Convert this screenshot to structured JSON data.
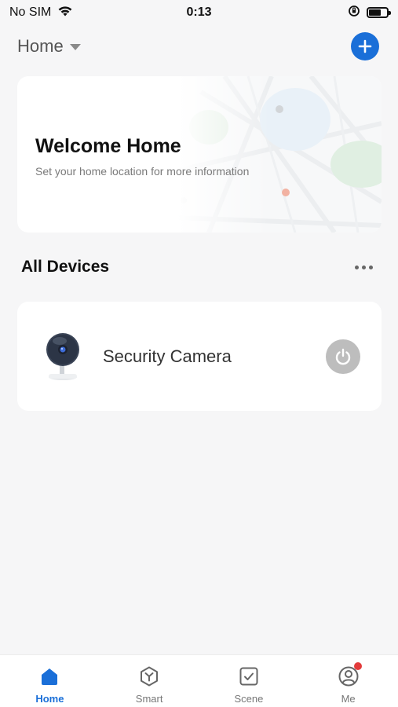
{
  "status_bar": {
    "carrier": "No SIM",
    "time": "0:13"
  },
  "header": {
    "home_label": "Home"
  },
  "welcome_card": {
    "title": "Welcome Home",
    "subtitle": "Set your home location for more information"
  },
  "devices": {
    "section_title": "All Devices",
    "items": [
      {
        "name": "Security Camera",
        "icon": "security-camera-icon",
        "power_state": "off"
      }
    ]
  },
  "bottom_nav": {
    "items": [
      {
        "label": "Home",
        "icon": "home-icon",
        "active": true
      },
      {
        "label": "Smart",
        "icon": "smart-icon",
        "active": false
      },
      {
        "label": "Scene",
        "icon": "scene-icon",
        "active": false
      },
      {
        "label": "Me",
        "icon": "profile-icon",
        "active": false,
        "badge": true
      }
    ]
  },
  "colors": {
    "accent": "#1a6fd8",
    "background": "#f6f6f7",
    "badge": "#e33b3b",
    "power_inactive": "#bdbdbd"
  }
}
